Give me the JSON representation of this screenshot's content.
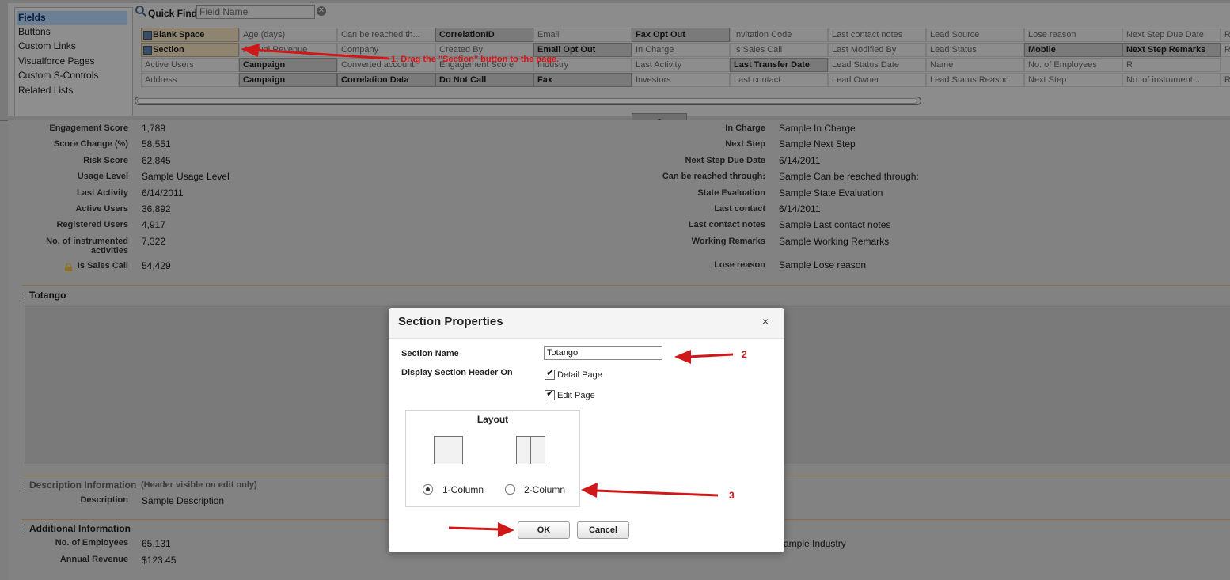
{
  "palette": {
    "categories": [
      "Fields",
      "Buttons",
      "Custom Links",
      "Visualforce Pages",
      "Custom S-Controls",
      "Related Lists"
    ],
    "quick_find_label": "Quick Find",
    "quick_find_placeholder": "Field Name",
    "grid": [
      [
        "Blank Space",
        "Age (days)",
        "Can be reached th...",
        "CorrelationID",
        "Email",
        "Fax Opt Out",
        "Invitation Code",
        "Last contact notes",
        "Lead Source",
        "Lose reason",
        "Next Step Due Date",
        "R"
      ],
      [
        "Section",
        "Annual Revenue",
        "Company",
        "Created By",
        "Email Opt Out",
        "In Charge",
        "Is Sales Call",
        "Last Modified By",
        "Lead Status",
        "Mobile",
        "Next Step Remarks",
        "R"
      ],
      [
        "Active Users",
        "Campaign",
        "Converted account",
        "Engagement Score",
        "Industry",
        "Last Activity",
        "Last Transfer Date",
        "Lead Status Date",
        "Name",
        "No. of Employees",
        "R",
        ""
      ],
      [
        "Address",
        "Campaign",
        "Correlation Data",
        "Do Not Call",
        "Fax",
        "Investors",
        "Last contact",
        "Lead Owner",
        "Lead Status Reason",
        "Next Step",
        "No. of instrument...",
        "R"
      ]
    ]
  },
  "details_left": [
    {
      "label": "Engagement Score",
      "value": "1,789"
    },
    {
      "label": "Score Change (%)",
      "value": "58,551"
    },
    {
      "label": "Risk Score",
      "value": "62,845"
    },
    {
      "label": "Usage Level",
      "value": "Sample Usage Level"
    },
    {
      "label": "Last Activity",
      "value": "6/14/2011"
    },
    {
      "label": "Active Users",
      "value": "36,892"
    },
    {
      "label": "Registered Users",
      "value": "4,917"
    },
    {
      "label": "No. of instrumented",
      "label2": "activities",
      "value": "7,322"
    },
    {
      "label": "Is Sales Call",
      "value": "54,429"
    }
  ],
  "details_right": [
    {
      "label": "In Charge",
      "value": "Sample In Charge"
    },
    {
      "label": "Next Step",
      "value": "Sample Next Step"
    },
    {
      "label": "Next Step Due Date",
      "value": "6/14/2011"
    },
    {
      "label": "Can be reached through:",
      "value": "Sample Can be reached through:"
    },
    {
      "label": "State Evaluation",
      "value": "Sample State Evaluation"
    },
    {
      "label": "Last contact",
      "value": "6/14/2011"
    },
    {
      "label": "Last contact notes",
      "value": "Sample Last contact notes"
    },
    {
      "label": "Working Remarks",
      "value": "Sample Working Remarks"
    },
    {
      "label": "Lose reason",
      "value": "Sample Lose reason"
    }
  ],
  "sections": {
    "totango": "Totango",
    "description_title": "Description Information",
    "description_note": "(Header visible on edit only)",
    "description_label": "Description",
    "description_value": "Sample Description",
    "additional_title": "Additional Information",
    "employees_label": "No. of Employees",
    "employees_value": "65,131",
    "revenue_label": "Annual Revenue",
    "revenue_value": "$123.45",
    "industry_value": "ample Industry"
  },
  "dialog": {
    "title": "Section Properties",
    "close": "×",
    "section_name_label": "Section Name",
    "section_name_value": "Totango",
    "display_header_label": "Display Section Header On",
    "detail_page_label": "Detail Page",
    "detail_page_checked": true,
    "edit_page_label": "Edit Page",
    "edit_page_checked": true,
    "layout_title": "Layout",
    "one_column_label": "1-Column",
    "two_column_label": "2-Column",
    "selected_layout": "1-Column",
    "ok_label": "OK",
    "cancel_label": "Cancel"
  },
  "annotations": {
    "step1": "1. Drag the \"Section\" button to the page.",
    "step2": "2",
    "step3": "3"
  },
  "colors": {
    "annotation": "#d01818",
    "overlay": "#7f7f7f",
    "section_rule": "#8f6a40"
  }
}
